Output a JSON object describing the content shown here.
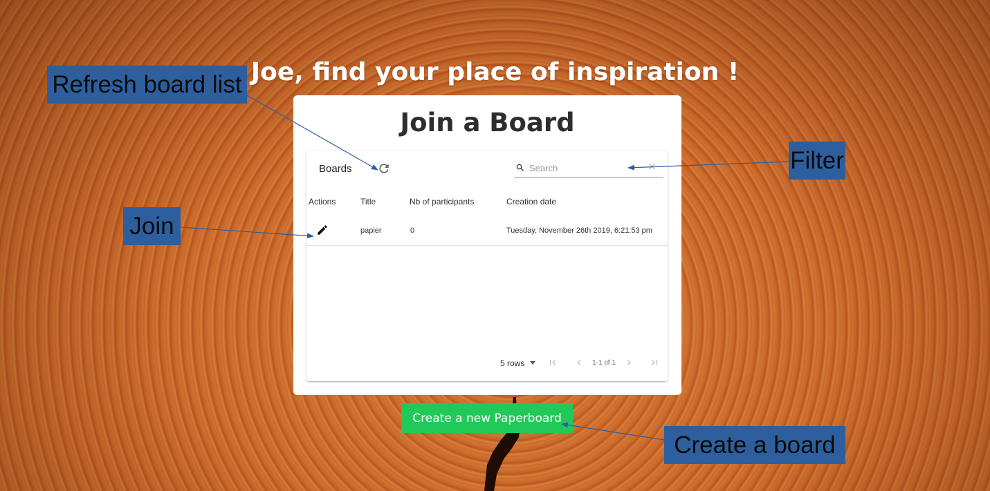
{
  "headline": "Joe, find your place of inspiration !",
  "card": {
    "title": "Join a Board"
  },
  "table": {
    "title": "Boards",
    "search_placeholder": "Search",
    "columns": [
      "Actions",
      "Title",
      "Nb of participants",
      "Creation date"
    ],
    "rows": [
      {
        "title": "papier",
        "participants": "0",
        "creation_date": "Tuesday, November 26th 2019, 6:21:53 pm"
      }
    ],
    "rows_per_page_label": "5 rows",
    "page_info": "1-1 of 1"
  },
  "create_button": {
    "label": "Create a new Paperboard"
  },
  "annotations": {
    "refresh": "Refresh board list",
    "filter": "Filter",
    "join": "Join",
    "create": "Create a board"
  },
  "colors": {
    "annotation_bg": "#2d5f9e",
    "create_button_bg": "#21c95b",
    "arrow": "#2d5f9e"
  },
  "icons": {
    "refresh": "refresh-icon",
    "search": "search-icon",
    "clear": "close-icon",
    "edit": "pencil-icon",
    "first_page": "first-page-icon",
    "prev_page": "chevron-left-icon",
    "next_page": "chevron-right-icon",
    "last_page": "last-page-icon",
    "dropdown": "caret-down-icon"
  }
}
